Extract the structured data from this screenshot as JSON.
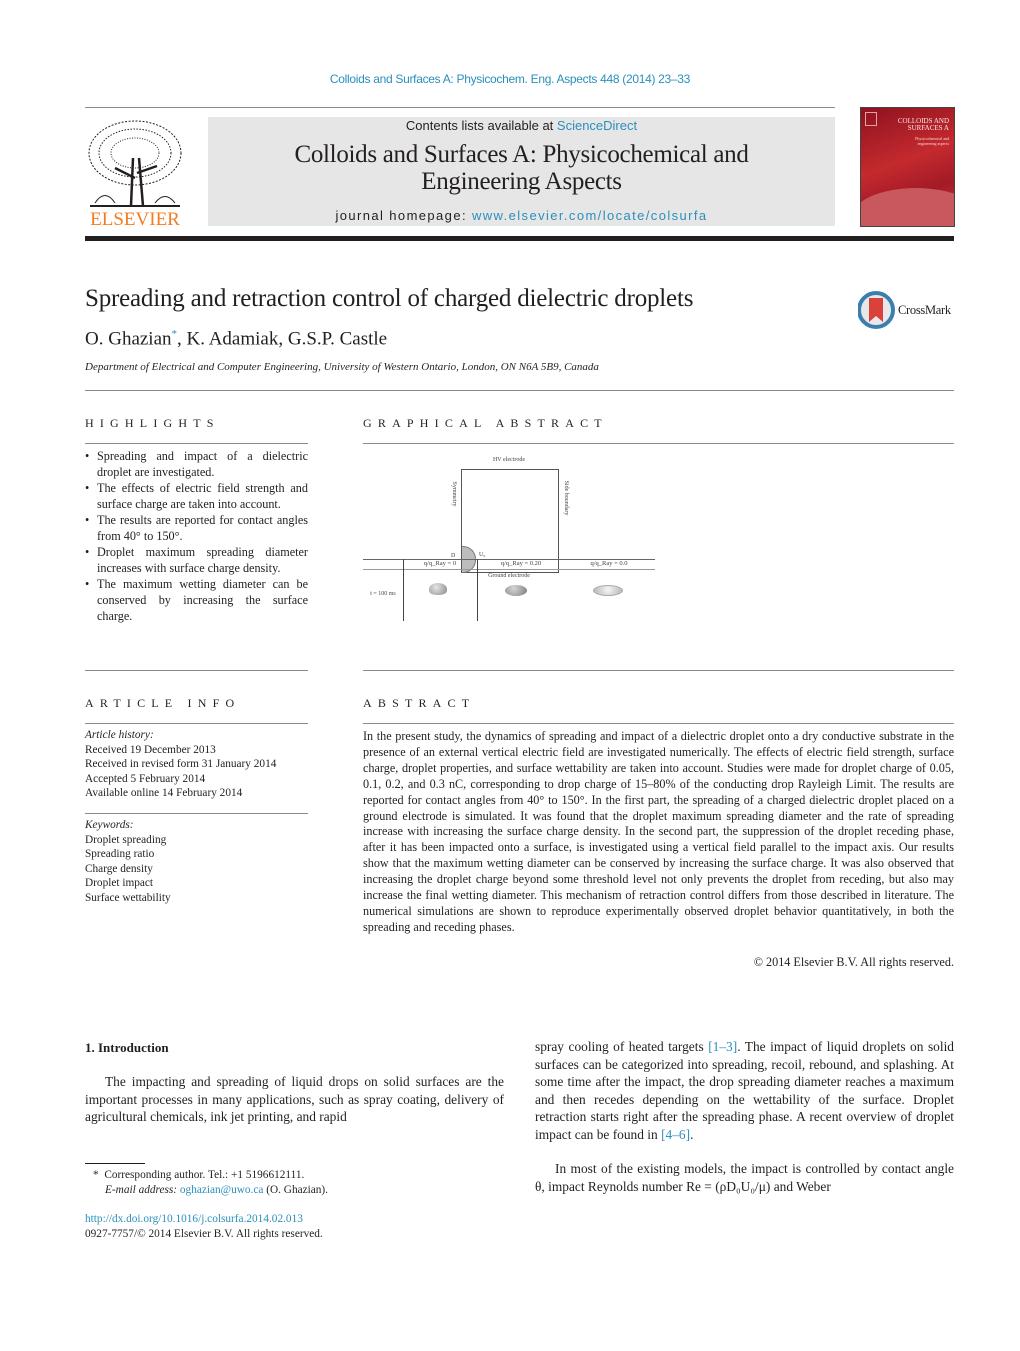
{
  "citation": "Colloids and Surfaces A: Physicochem. Eng. Aspects 448 (2014) 23–33",
  "header": {
    "publisher_logo_text": "ELSEVIER",
    "contents_prefix": "Contents lists available at ",
    "contents_link": "ScienceDirect",
    "journal_title_line1": "Colloids and Surfaces A: Physicochemical and",
    "journal_title_line2": "Engineering Aspects",
    "homepage_prefix": "journal homepage: ",
    "homepage_link": "www.elsevier.com/locate/colsurfa",
    "cover_title_line1": "COLLOIDS AND",
    "cover_title_line2": "SURFACES A",
    "cover_subtitle": "Physicochemical and engineering aspects"
  },
  "article": {
    "title": "Spreading and retraction control of charged dielectric droplets",
    "crossmark_label": "CrossMark",
    "authors": [
      {
        "name": "O. Ghazian",
        "mark": "*"
      },
      {
        "name": "K. Adamiak",
        "mark": ""
      },
      {
        "name": "G.S.P. Castle",
        "mark": ""
      }
    ],
    "affiliation": "Department of Electrical and Computer Engineering, University of Western Ontario, London, ON N6A 5B9, Canada"
  },
  "highlights": {
    "heading": "HIGHLIGHTS",
    "items": [
      "Spreading and impact of a dielectric droplet are investigated.",
      "The effects of electric field strength and surface charge are taken into account.",
      "The results are reported for contact angles from 40° to 150°.",
      "Droplet maximum spreading diameter increases with surface charge density.",
      "The maximum wetting diameter can be conserved by increasing the surface charge."
    ]
  },
  "graphical_abstract": {
    "heading": "GRAPHICAL ABSTRACT",
    "labels": {
      "top": "HV electrode",
      "left": "Symmetry",
      "right": "Side boundary",
      "bottom": "Ground electrode",
      "drop_d": "D",
      "drop_u": "U₀"
    },
    "table": {
      "columns": [
        "q/q_Ray = 0",
        "q/q_Ray = 0.20",
        "q/q_Ray = 0.0"
      ],
      "row_label": "t = 100 ms"
    }
  },
  "article_info": {
    "heading": "ARTICLE INFO",
    "history_label": "Article history:",
    "history": [
      "Received 19 December 2013",
      "Received in revised form 31 January 2014",
      "Accepted 5 February 2014",
      "Available online 14 February 2014"
    ],
    "keywords_label": "Keywords:",
    "keywords": [
      "Droplet spreading",
      "Spreading ratio",
      "Charge density",
      "Droplet impact",
      "Surface wettability"
    ]
  },
  "abstract": {
    "heading": "ABSTRACT",
    "text": "In the present study, the dynamics of spreading and impact of a dielectric droplet onto a dry conductive substrate in the presence of an external vertical electric field are investigated numerically. The effects of electric field strength, surface charge, droplet properties, and surface wettability are taken into account. Studies were made for droplet charge of 0.05, 0.1, 0.2, and 0.3 nC, corresponding to drop charge of 15–80% of the conducting drop Rayleigh Limit. The results are reported for contact angles from 40° to 150°. In the first part, the spreading of a charged dielectric droplet placed on a ground electrode is simulated. It was found that the droplet maximum spreading diameter and the rate of spreading increase with increasing the surface charge density. In the second part, the suppression of the droplet receding phase, after it has been impacted onto a surface, is investigated using a vertical field parallel to the impact axis. Our results show that the maximum wetting diameter can be conserved by increasing the surface charge. It was also observed that increasing the droplet charge beyond some threshold level not only prevents the droplet from receding, but also may increase the final wetting diameter. This mechanism of retraction control differs from those described in literature. The numerical simulations are shown to reproduce experimentally observed droplet behavior quantitatively, in both the spreading and receding phases.",
    "copyright": "© 2014 Elsevier B.V. All rights reserved."
  },
  "introduction": {
    "heading": "1.  Introduction",
    "left_para": "The impacting and spreading of liquid drops on solid surfaces are the important processes in many applications, such as spray coating, delivery of agricultural chemicals, ink jet printing, and rapid",
    "right_p1_a": "spray cooling of heated targets ",
    "right_p1_ref1": "[1–3]",
    "right_p1_b": ". The impact of liquid droplets on solid surfaces can be categorized into spreading, recoil, rebound, and splashing. At some time after the impact, the drop spreading diameter reaches a maximum and then recedes depending on the wettability of the surface. Droplet retraction starts right after the spreading phase. A recent overview of droplet impact can be found in ",
    "right_p1_ref2": "[4–6]",
    "right_p1_c": ".",
    "right_p2": "In most of the existing models, the impact is controlled by contact angle θ, impact Reynolds number Re = (ρD₀U₀/μ) and Weber"
  },
  "footnote": {
    "mark": "*",
    "line1": "Corresponding author. Tel.: +1 5196612111.",
    "email_label": "E-mail address: ",
    "email": "oghazian@uwo.ca",
    "email_suffix": " (O. Ghazian).",
    "doi": "http://dx.doi.org/10.1016/j.colsurfa.2014.02.013",
    "issn": "0927-7757/© 2014 Elsevier B.V. All rights reserved."
  }
}
